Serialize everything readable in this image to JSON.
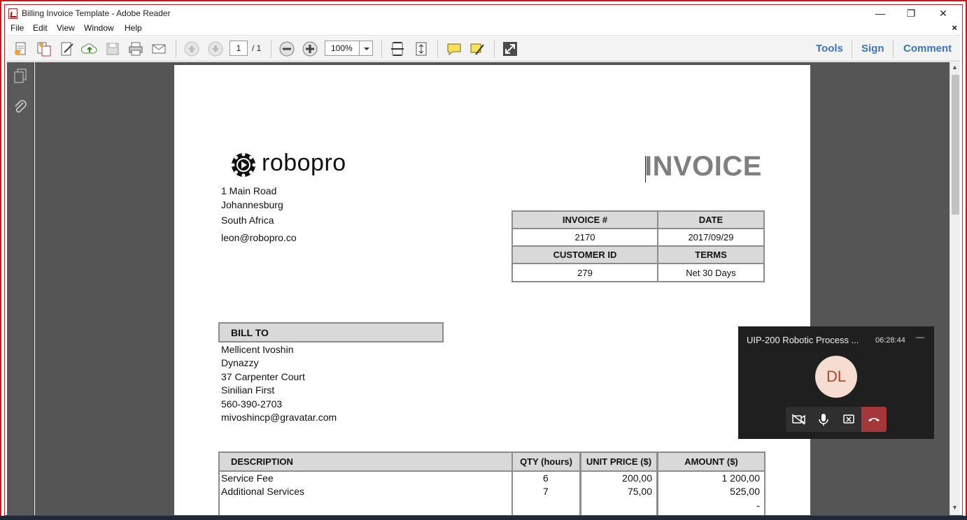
{
  "window": {
    "title": "Billing Invoice Template - Adobe Reader",
    "minimize": "—",
    "restore": "❐",
    "close": "✕"
  },
  "menu": {
    "items": [
      "File",
      "Edit",
      "View",
      "Window",
      "Help"
    ],
    "close": "×"
  },
  "toolbar": {
    "page_current": "1",
    "page_total": "/ 1",
    "zoom": "100%",
    "tools": "Tools",
    "sign": "Sign",
    "comment": "Comment"
  },
  "document": {
    "logo_text": "robopro",
    "heading": "INVOICE",
    "sender": {
      "line1": "1 Main Road",
      "line2": "Johannesburg",
      "line3": "South Africa",
      "email": "leon@robopro.co"
    },
    "meta": {
      "invoice_label": "INVOICE #",
      "date_label": "DATE",
      "invoice_no": "2170",
      "date": "2017/09/29",
      "customer_label": "CUSTOMER ID",
      "terms_label": "TERMS",
      "customer_id": "279",
      "terms": "Net 30 Days"
    },
    "bill_to_label": "BILL TO",
    "bill_to": {
      "name": "Mellicent Ivoshin",
      "company": "Dynazzy",
      "street": "37 Carpenter Court",
      "city": "Sinilian First",
      "phone": "560-390-2703",
      "email": "mivoshincp@gravatar.com"
    },
    "line_items": {
      "headers": {
        "description": "DESCRIPTION",
        "qty": "QTY (hours)",
        "unit_price": "UNIT PRICE ($)",
        "amount": "AMOUNT ($)"
      },
      "rows": [
        {
          "description": "Service Fee",
          "qty": "6",
          "unit_price": "200,00",
          "amount": "1 200,00"
        },
        {
          "description": "Additional Services",
          "qty": "7",
          "unit_price": "75,00",
          "amount": "525,00"
        },
        {
          "description": "",
          "qty": "",
          "unit_price": "",
          "amount": "-"
        }
      ]
    }
  },
  "call_popup": {
    "title": "UIP-200 Robotic Process ...",
    "timer": "06:28:44",
    "minimize": "—",
    "avatar_initials": "DL"
  }
}
